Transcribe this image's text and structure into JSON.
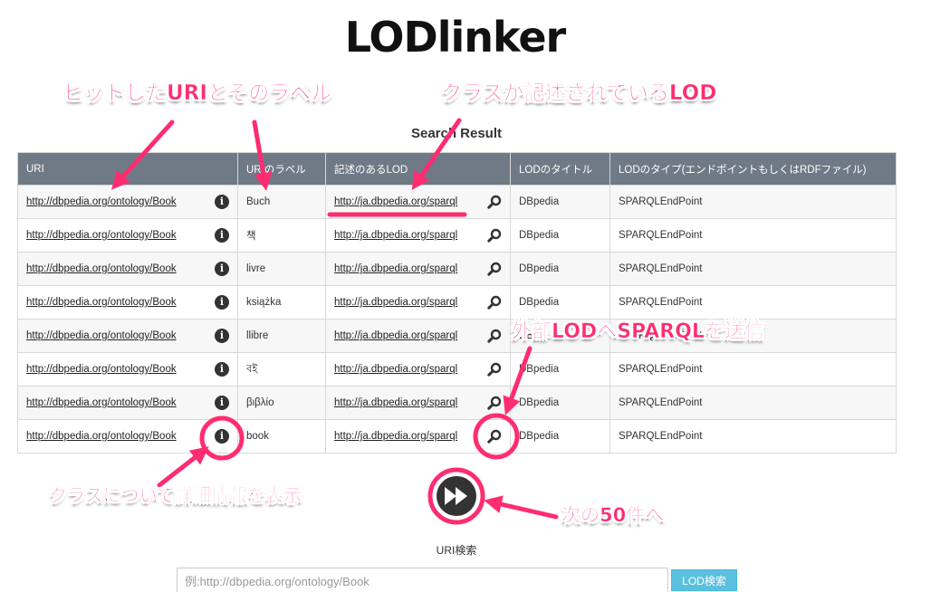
{
  "app": {
    "title": "LODlinker"
  },
  "table": {
    "caption": "Search Result",
    "headers": [
      "URI",
      "URIのラベル",
      "記述のあるLOD",
      "LODのタイトル",
      "LODのタイプ(エンドポイントもしくはRDFファイル)"
    ],
    "rows": [
      {
        "uri": "http://dbpedia.org/ontology/Book",
        "label": "Buch",
        "lod": "http://ja.dbpedia.org/sparql",
        "title": "DBpedia",
        "type": "SPARQLEndPoint"
      },
      {
        "uri": "http://dbpedia.org/ontology/Book",
        "label": "책",
        "lod": "http://ja.dbpedia.org/sparql",
        "title": "DBpedia",
        "type": "SPARQLEndPoint"
      },
      {
        "uri": "http://dbpedia.org/ontology/Book",
        "label": "livre",
        "lod": "http://ja.dbpedia.org/sparql",
        "title": "DBpedia",
        "type": "SPARQLEndPoint"
      },
      {
        "uri": "http://dbpedia.org/ontology/Book",
        "label": "książka",
        "lod": "http://ja.dbpedia.org/sparql",
        "title": "DBpedia",
        "type": "SPARQLEndPoint"
      },
      {
        "uri": "http://dbpedia.org/ontology/Book",
        "label": "llibre",
        "lod": "http://ja.dbpedia.org/sparql",
        "title": "DBpedia",
        "type": "SPARQLEndPoint"
      },
      {
        "uri": "http://dbpedia.org/ontology/Book",
        "label": "বই",
        "lod": "http://ja.dbpedia.org/sparql",
        "title": "DBpedia",
        "type": "SPARQLEndPoint"
      },
      {
        "uri": "http://dbpedia.org/ontology/Book",
        "label": "βιβλίο",
        "lod": "http://ja.dbpedia.org/sparql",
        "title": "DBpedia",
        "type": "SPARQLEndPoint"
      },
      {
        "uri": "http://dbpedia.org/ontology/Book",
        "label": "book",
        "lod": "http://ja.dbpedia.org/sparql",
        "title": "DBpedia",
        "type": "SPARQLEndPoint"
      }
    ]
  },
  "icons": {
    "info": "info-icon",
    "search": "search-icon",
    "next": "fast-forward-icon"
  },
  "search": {
    "label": "URI検索",
    "placeholder": "例:http://dbpedia.org/ontology/Book",
    "button_label": "LOD検索"
  },
  "annotations": {
    "hit_uri": "ヒットしたURIとそのラベル",
    "class_lod": "クラスが記述されているLOD",
    "send_sparql": "外部LODへSPARQLを送信",
    "class_info": "クラスについて詳細情報を表示",
    "next_50": "次の50件へ"
  },
  "colors": {
    "header_bg": "#6f7a86",
    "accent": "#ff2d6f",
    "search_button": "#5bc0de"
  }
}
